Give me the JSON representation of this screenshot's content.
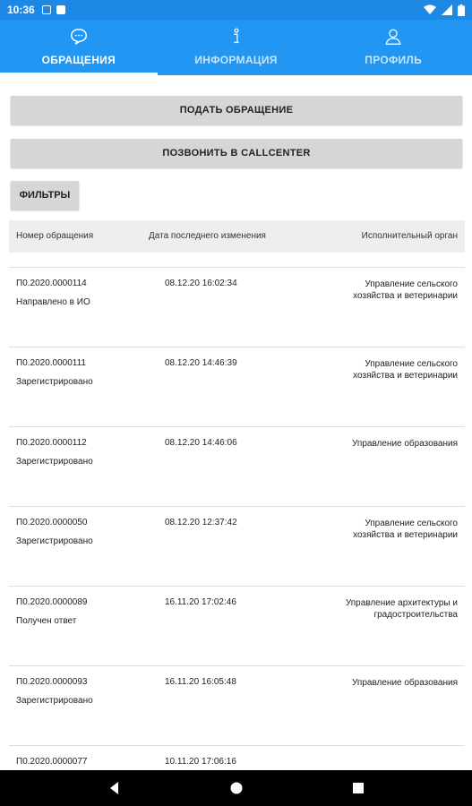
{
  "status_bar": {
    "time": "10:36"
  },
  "tabs": [
    {
      "label": "ОБРАЩЕНИЯ",
      "icon": "chat-bubble-icon",
      "active": true
    },
    {
      "label": "ИНФОРМАЦИЯ",
      "icon": "info-icon",
      "active": false
    },
    {
      "label": "ПРОФИЛЬ",
      "icon": "person-icon",
      "active": false
    }
  ],
  "actions": {
    "submit_label": "ПОДАТЬ ОБРАЩЕНИЕ",
    "call_label": "ПОЗВОНИТЬ В CALLCENTER",
    "filter_label": "ФИЛЬТРЫ"
  },
  "table": {
    "headers": [
      "Номер обращения",
      "Дата последнего изменения",
      "Исполнительный орган"
    ],
    "rows": [
      {
        "number": "П0.2020.0000114",
        "status": "Направлено в ИО",
        "date": "08.12.20 16:02:34",
        "org": "Управление сельского хозяйства и ветеринарии"
      },
      {
        "number": "П0.2020.0000111",
        "status": "Зарегистрировано",
        "date": "08.12.20 14:46:39",
        "org": "Управление сельского хозяйства и ветеринарии"
      },
      {
        "number": "П0.2020.0000112",
        "status": "Зарегистрировано",
        "date": "08.12.20 14:46:06",
        "org": "Управление образования"
      },
      {
        "number": "П0.2020.0000050",
        "status": "Зарегистрировано",
        "date": "08.12.20 12:37:42",
        "org": "Управление сельского хозяйства и ветеринарии"
      },
      {
        "number": "П0.2020.0000089",
        "status": "Получен ответ",
        "date": "16.11.20 17:02:46",
        "org": "Управление архитектуры и градостроительства"
      },
      {
        "number": "П0.2020.0000093",
        "status": "Зарегистрировано",
        "date": "16.11.20 16:05:48",
        "org": "Управление образования"
      },
      {
        "number": "П0.2020.0000077",
        "status": "",
        "date": "10.11.20 17:06:16",
        "org": ""
      }
    ]
  },
  "colors": {
    "primary": "#2196f3",
    "status_bar": "#1e88e5",
    "button": "#d6d6d6"
  }
}
